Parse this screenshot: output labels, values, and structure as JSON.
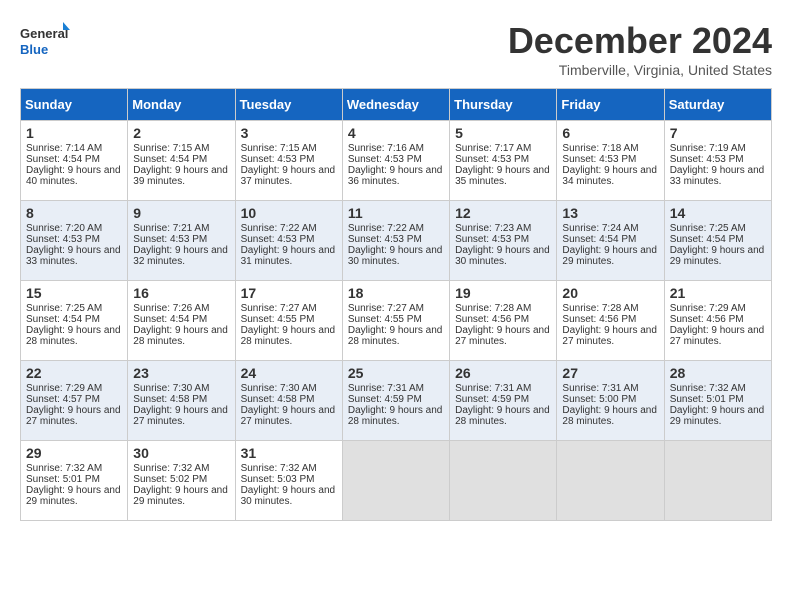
{
  "logo": {
    "line1": "General",
    "line2": "Blue"
  },
  "title": "December 2024",
  "subtitle": "Timberville, Virginia, United States",
  "days_of_week": [
    "Sunday",
    "Monday",
    "Tuesday",
    "Wednesday",
    "Thursday",
    "Friday",
    "Saturday"
  ],
  "weeks": [
    [
      {
        "day": "1",
        "data": "Sunrise: 7:14 AM\nSunset: 4:54 PM\nDaylight: 9 hours and 40 minutes."
      },
      {
        "day": "2",
        "data": "Sunrise: 7:15 AM\nSunset: 4:54 PM\nDaylight: 9 hours and 39 minutes."
      },
      {
        "day": "3",
        "data": "Sunrise: 7:15 AM\nSunset: 4:53 PM\nDaylight: 9 hours and 37 minutes."
      },
      {
        "day": "4",
        "data": "Sunrise: 7:16 AM\nSunset: 4:53 PM\nDaylight: 9 hours and 36 minutes."
      },
      {
        "day": "5",
        "data": "Sunrise: 7:17 AM\nSunset: 4:53 PM\nDaylight: 9 hours and 35 minutes."
      },
      {
        "day": "6",
        "data": "Sunrise: 7:18 AM\nSunset: 4:53 PM\nDaylight: 9 hours and 34 minutes."
      },
      {
        "day": "7",
        "data": "Sunrise: 7:19 AM\nSunset: 4:53 PM\nDaylight: 9 hours and 33 minutes."
      }
    ],
    [
      {
        "day": "8",
        "data": "Sunrise: 7:20 AM\nSunset: 4:53 PM\nDaylight: 9 hours and 33 minutes."
      },
      {
        "day": "9",
        "data": "Sunrise: 7:21 AM\nSunset: 4:53 PM\nDaylight: 9 hours and 32 minutes."
      },
      {
        "day": "10",
        "data": "Sunrise: 7:22 AM\nSunset: 4:53 PM\nDaylight: 9 hours and 31 minutes."
      },
      {
        "day": "11",
        "data": "Sunrise: 7:22 AM\nSunset: 4:53 PM\nDaylight: 9 hours and 30 minutes."
      },
      {
        "day": "12",
        "data": "Sunrise: 7:23 AM\nSunset: 4:53 PM\nDaylight: 9 hours and 30 minutes."
      },
      {
        "day": "13",
        "data": "Sunrise: 7:24 AM\nSunset: 4:54 PM\nDaylight: 9 hours and 29 minutes."
      },
      {
        "day": "14",
        "data": "Sunrise: 7:25 AM\nSunset: 4:54 PM\nDaylight: 9 hours and 29 minutes."
      }
    ],
    [
      {
        "day": "15",
        "data": "Sunrise: 7:25 AM\nSunset: 4:54 PM\nDaylight: 9 hours and 28 minutes."
      },
      {
        "day": "16",
        "data": "Sunrise: 7:26 AM\nSunset: 4:54 PM\nDaylight: 9 hours and 28 minutes."
      },
      {
        "day": "17",
        "data": "Sunrise: 7:27 AM\nSunset: 4:55 PM\nDaylight: 9 hours and 28 minutes."
      },
      {
        "day": "18",
        "data": "Sunrise: 7:27 AM\nSunset: 4:55 PM\nDaylight: 9 hours and 28 minutes."
      },
      {
        "day": "19",
        "data": "Sunrise: 7:28 AM\nSunset: 4:56 PM\nDaylight: 9 hours and 27 minutes."
      },
      {
        "day": "20",
        "data": "Sunrise: 7:28 AM\nSunset: 4:56 PM\nDaylight: 9 hours and 27 minutes."
      },
      {
        "day": "21",
        "data": "Sunrise: 7:29 AM\nSunset: 4:56 PM\nDaylight: 9 hours and 27 minutes."
      }
    ],
    [
      {
        "day": "22",
        "data": "Sunrise: 7:29 AM\nSunset: 4:57 PM\nDaylight: 9 hours and 27 minutes."
      },
      {
        "day": "23",
        "data": "Sunrise: 7:30 AM\nSunset: 4:58 PM\nDaylight: 9 hours and 27 minutes."
      },
      {
        "day": "24",
        "data": "Sunrise: 7:30 AM\nSunset: 4:58 PM\nDaylight: 9 hours and 27 minutes."
      },
      {
        "day": "25",
        "data": "Sunrise: 7:31 AM\nSunset: 4:59 PM\nDaylight: 9 hours and 28 minutes."
      },
      {
        "day": "26",
        "data": "Sunrise: 7:31 AM\nSunset: 4:59 PM\nDaylight: 9 hours and 28 minutes."
      },
      {
        "day": "27",
        "data": "Sunrise: 7:31 AM\nSunset: 5:00 PM\nDaylight: 9 hours and 28 minutes."
      },
      {
        "day": "28",
        "data": "Sunrise: 7:32 AM\nSunset: 5:01 PM\nDaylight: 9 hours and 29 minutes."
      }
    ],
    [
      {
        "day": "29",
        "data": "Sunrise: 7:32 AM\nSunset: 5:01 PM\nDaylight: 9 hours and 29 minutes."
      },
      {
        "day": "30",
        "data": "Sunrise: 7:32 AM\nSunset: 5:02 PM\nDaylight: 9 hours and 29 minutes."
      },
      {
        "day": "31",
        "data": "Sunrise: 7:32 AM\nSunset: 5:03 PM\nDaylight: 9 hours and 30 minutes."
      },
      {
        "day": "",
        "data": ""
      },
      {
        "day": "",
        "data": ""
      },
      {
        "day": "",
        "data": ""
      },
      {
        "day": "",
        "data": ""
      }
    ]
  ]
}
